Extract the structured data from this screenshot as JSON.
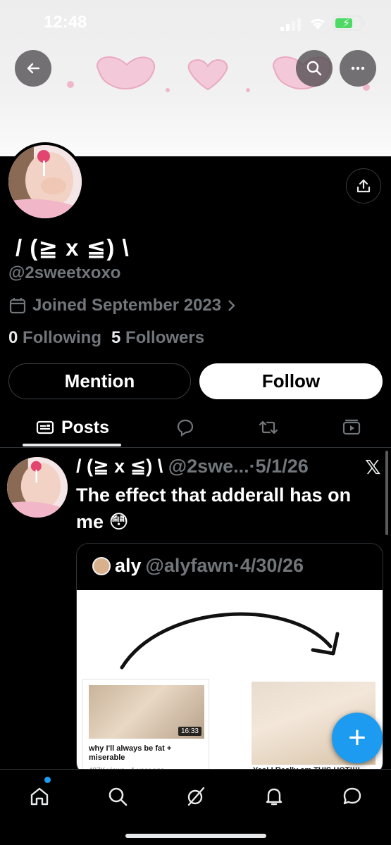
{
  "status_bar": {
    "time": "12:48"
  },
  "header": {
    "back": "back-arrow-icon",
    "search": "search-icon",
    "more": "more-icon"
  },
  "profile": {
    "display_name": "/ (≧ x ≦) \\",
    "handle": "@2sweetxoxo",
    "joined": "Joined September 2023",
    "following_count": "0",
    "following_label": "Following",
    "followers_count": "5",
    "followers_label": "Followers"
  },
  "actions": {
    "mention": "Mention",
    "follow": "Follow"
  },
  "tabs": {
    "posts": "Posts"
  },
  "post": {
    "display_name": "/ (≧ x ≦) \\",
    "handle_date": "@2swe...·5/1/26",
    "text": "The effect that adderall has on me 😳",
    "quote": {
      "name": "aly",
      "meta": "@alyfawn·4/30/26",
      "video1_title": "why I'll always be fat + miserable",
      "video1_meta": "497K views · 1 year ago",
      "video1_duration": "16:33",
      "video2_title": "Yes! I Really am THIS HOT!!!!"
    }
  },
  "fab": {
    "label": "+"
  },
  "colors": {
    "accent": "#1d9bf0",
    "muted": "#71767b"
  }
}
